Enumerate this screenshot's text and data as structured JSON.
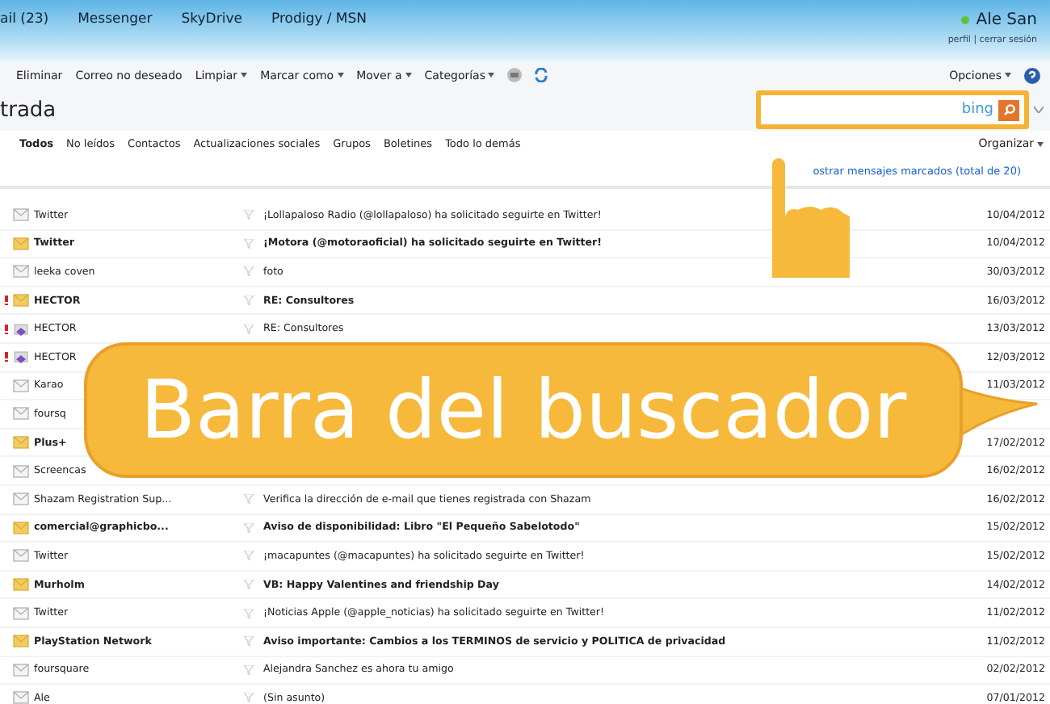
{
  "nav": {
    "items": [
      "ail (23)",
      "Messenger",
      "SkyDrive",
      "Prodigy / MSN"
    ],
    "user": "Ale San",
    "online": true,
    "links": "perfil | cerrar sesión"
  },
  "toolbar": {
    "items": [
      {
        "label": "Eliminar",
        "menu": false
      },
      {
        "label": "Correo no deseado",
        "menu": false
      },
      {
        "label": "Limpiar",
        "menu": true
      },
      {
        "label": "Marcar como",
        "menu": true
      },
      {
        "label": "Mover a",
        "menu": true
      },
      {
        "label": "Categorías",
        "menu": true
      }
    ],
    "options": "Opciones"
  },
  "folder_title": "trada",
  "filters": [
    {
      "label": "Todos",
      "selected": true
    },
    {
      "label": "No leídos",
      "selected": false
    },
    {
      "label": "Contactos",
      "selected": false
    },
    {
      "label": "Actualizaciones sociales",
      "selected": false
    },
    {
      "label": "Grupos",
      "selected": false
    },
    {
      "label": "Boletines",
      "selected": false
    },
    {
      "label": "Todo lo demás",
      "selected": false
    }
  ],
  "organize": "Organizar",
  "flagged_link": "ostrar mensajes marcados (total de 20)",
  "search": {
    "brand": "bing"
  },
  "messages": [
    {
      "kind": "read",
      "important": false,
      "sender": "Twitter",
      "subject": "¡Lollapaloso Radio (@lollapaloso) ha solicitado seguirte en Twitter!",
      "date": "10/04/2012"
    },
    {
      "kind": "unread",
      "important": false,
      "sender": "Twitter",
      "subject": "¡Motora (@motoraoficial) ha solicitado seguirte en Twitter!",
      "date": "10/04/2012"
    },
    {
      "kind": "read",
      "important": false,
      "sender": "leeka coven",
      "subject": "foto",
      "date": "30/03/2012"
    },
    {
      "kind": "unread",
      "important": true,
      "sender": "HECTOR",
      "subject": "RE: Consultores",
      "date": "16/03/2012"
    },
    {
      "kind": "replied",
      "important": true,
      "sender": "HECTOR",
      "subject": "RE: Consultores",
      "date": "13/03/2012"
    },
    {
      "kind": "replied",
      "important": true,
      "sender": "HECTOR",
      "date": "12/03/2012"
    },
    {
      "kind": "read",
      "important": false,
      "sender": "Karao",
      "date": "11/03/2012"
    },
    {
      "kind": "read",
      "important": false,
      "sender": "foursq"
    },
    {
      "kind": "unread",
      "important": false,
      "sender": "Plus+",
      "date": "17/02/2012"
    },
    {
      "kind": "read",
      "important": false,
      "sender": "Screencas",
      "date": "16/02/2012"
    },
    {
      "kind": "read",
      "important": false,
      "sender": "Shazam Registration Sup...",
      "subject": "Verifica la dirección de e-mail que tienes registrada con Shazam",
      "date": "16/02/2012"
    },
    {
      "kind": "unread",
      "important": false,
      "sender": "comercial@graphicbo...",
      "subject": "Aviso de disponibilidad: Libro \"El Pequeño Sabelotodo\"",
      "date": "15/02/2012"
    },
    {
      "kind": "read",
      "important": false,
      "sender": "Twitter",
      "subject": "¡macapuntes  (@macapuntes) ha solicitado seguirte en Twitter!",
      "date": "15/02/2012"
    },
    {
      "kind": "unread",
      "important": false,
      "sender": "Murholm",
      "subject": "VB: Happy Valentines and friendship Day",
      "date": "14/02/2012"
    },
    {
      "kind": "read",
      "important": false,
      "sender": "Twitter",
      "subject": "¡Noticias Apple (@apple_noticias) ha solicitado seguirte en Twitter!",
      "date": "11/02/2012"
    },
    {
      "kind": "unread",
      "important": false,
      "sender": "PlayStation Network",
      "subject": "Aviso importante: Cambios a los TERMINOS de servicio y POLITICA de privacidad",
      "date": "11/02/2012"
    },
    {
      "kind": "read",
      "important": false,
      "sender": "foursquare",
      "subject": "Alejandra Sanchez es ahora tu amigo",
      "date": "02/02/2012"
    },
    {
      "kind": "read",
      "important": false,
      "sender": "Ale",
      "subject": "(Sin asunto)",
      "date": "07/01/2012"
    }
  ],
  "callout": "Barra del buscador"
}
